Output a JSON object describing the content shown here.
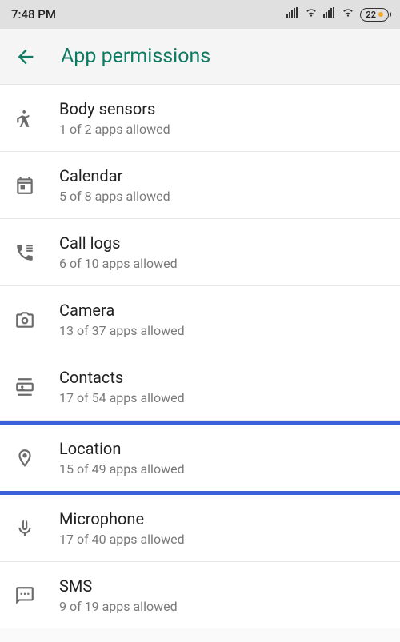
{
  "status": {
    "time": "7:48 PM",
    "battery": "22"
  },
  "header": {
    "title": "App permissions"
  },
  "permissions": [
    {
      "title": "Body sensors",
      "sub": "1 of 2 apps allowed"
    },
    {
      "title": "Calendar",
      "sub": "5 of 8 apps allowed"
    },
    {
      "title": "Call logs",
      "sub": "6 of 10 apps allowed"
    },
    {
      "title": "Camera",
      "sub": "13 of 37 apps allowed"
    },
    {
      "title": "Contacts",
      "sub": "17 of 54 apps allowed"
    },
    {
      "title": "Location",
      "sub": "15 of 49 apps allowed"
    },
    {
      "title": "Microphone",
      "sub": "17 of 40 apps allowed"
    },
    {
      "title": "SMS",
      "sub": "9 of 19 apps allowed"
    }
  ]
}
